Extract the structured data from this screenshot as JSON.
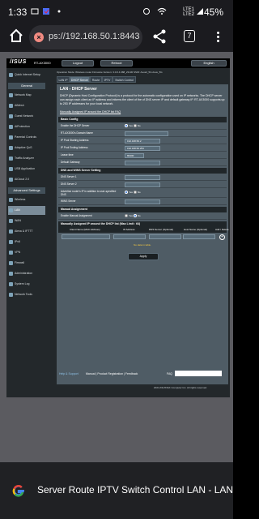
{
  "status_bar": {
    "time": "1:33",
    "network_labels": [
      "Vo)",
      "LTE1",
      "LTE2"
    ],
    "battery": "45%"
  },
  "browser": {
    "url": "ps://192.168.50.1:8443",
    "tab_count": "7"
  },
  "router": {
    "brand": "/ISUS",
    "model": "RT-AX3000",
    "logout_label": "Logout",
    "reboot_label": "Reboot",
    "language_label": "English",
    "operation_mode_text": "Operation Mode: Wireless router  Firmware Version: 3.0.0.4.388_23130  SSID: Asus2_5G  Asus_5G",
    "sidebar": {
      "quick_setup": "Quick Internet Setup",
      "general_header": "General",
      "general_items": [
        "Network Map",
        "AiMesh",
        "Guest Network",
        "AiProtection",
        "Parental Controls",
        "Adaptive QoS",
        "Traffic Analyzer",
        "USB Application",
        "AiCloud 2.0"
      ],
      "advanced_header": "Advanced Settings",
      "advanced_items": [
        "Wireless",
        "LAN",
        "WAN",
        "Alexa & IFTTT",
        "IPv6",
        "VPN",
        "Firewall",
        "Administration",
        "System Log",
        "Network Tools"
      ],
      "active_item": "LAN"
    },
    "tabs": [
      "LAN IP",
      "DHCP Server",
      "Route",
      "IPTV",
      "Switch Control"
    ],
    "active_tab": "DHCP Server",
    "panel": {
      "title": "LAN - DHCP Server",
      "description": "DHCP (Dynamic Host Configuration Protocol) is a protocol for the automatic configuration used on IP networks. The DHCP server can assign each client an IP address and informs the client of the of DNS server IP and default gateway IP. RT-AX3000 supports up to 253 IP addresses for your local network.",
      "manual_link": "Manually Assigned IP around the DHCP list FAQ",
      "basic_config": {
        "header": "Basic Config",
        "rows": [
          {
            "label": "Enable the DHCP Server",
            "type": "radio",
            "yes": "Yes",
            "no": "No",
            "selected": "Yes"
          },
          {
            "label": "RT-AX3000's Domain Name",
            "type": "input",
            "value": ""
          },
          {
            "label": "IP Pool Starting Address",
            "type": "input",
            "value": "192.168.50.2"
          },
          {
            "label": "IP Pool Ending Address",
            "type": "input",
            "value": "192.168.50.254"
          },
          {
            "label": "Lease time",
            "type": "input",
            "value": "86400"
          },
          {
            "label": "Default Gateway",
            "type": "input",
            "value": ""
          }
        ]
      },
      "dns_wins": {
        "header": "DNS and WINS Server Setting",
        "rows": [
          {
            "label": "DNS Server 1",
            "type": "input",
            "value": ""
          },
          {
            "label": "DNS Server 2",
            "type": "input",
            "value": ""
          },
          {
            "label": "Advertise router's IP in addition to user-specified DNS",
            "type": "radio",
            "yes": "Yes",
            "no": "No",
            "selected": "Yes"
          },
          {
            "label": "WINS Server",
            "type": "input",
            "value": ""
          }
        ]
      },
      "manual_assignment": {
        "header": "Manual Assignment",
        "rows": [
          {
            "label": "Enable Manual Assignment",
            "type": "radio",
            "yes": "Yes",
            "no": "No",
            "selected": "No"
          }
        ]
      },
      "manual_list": {
        "header": "Manually Assigned IP around the DHCP list (Max Limit : 64)",
        "columns": [
          "Client Name (MAC Address)",
          "IP Address",
          "DNS Server (Optional)",
          "Host Name (Optional)",
          "Add / Delete"
        ],
        "no_data": "No data in table.",
        "add_symbol": "+"
      },
      "apply_label": "Apply"
    },
    "footer": {
      "help": "Help & Support",
      "links": "Manual | Product Registration | Feedback",
      "faq": "FAQ",
      "copyright": "2024 ASUSTeK Computer Inc. All rights reserved."
    }
  },
  "suggestion": {
    "text": "Server  Route  IPTV  Switch Control   LAN - LAN"
  }
}
